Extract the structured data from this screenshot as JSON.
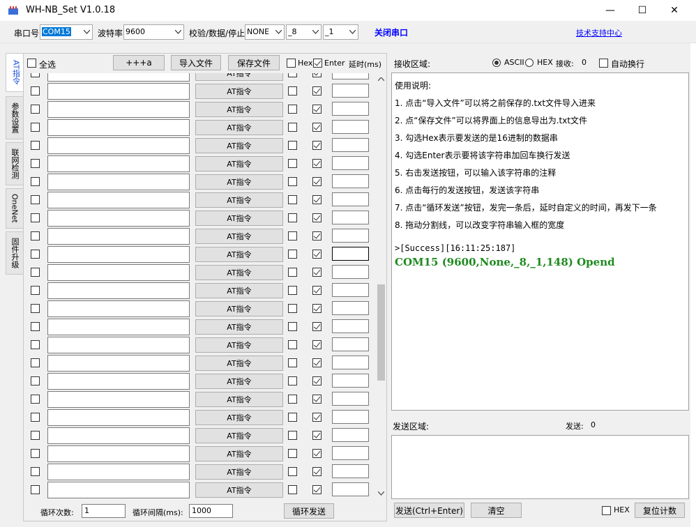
{
  "window": {
    "title": "WH-NB_Set V1.0.18",
    "minimize": "—",
    "maximize": "☐",
    "close": "✕"
  },
  "toolbar": {
    "port_label": "串口号",
    "port_value": "COM15",
    "baud_label": "波特率",
    "baud_value": "9600",
    "parity_label": "校验/数据/停止",
    "parity_value": "NONE",
    "data_bits_value": "_8",
    "stop_bits_value": "_1",
    "close_port_label": "关闭串口",
    "support_link": "技术支持中心"
  },
  "tabs": [
    {
      "label": "AT指令",
      "active": true
    },
    {
      "label": "参数设置",
      "active": false
    },
    {
      "label": "联网检测",
      "active": false
    },
    {
      "label": "OneNet",
      "active": false
    },
    {
      "label": "固件升级",
      "active": false
    }
  ],
  "left_panel": {
    "select_all_label": "全选",
    "plus_button": "+++a",
    "import_button": "导入文件",
    "save_button": "保存文件",
    "hex_label": "Hex",
    "enter_label": "Enter",
    "delay_label": "延时(ms)",
    "at_button_label": "AT指令",
    "row_count": 24,
    "loop_count_label": "循环次数:",
    "loop_count_value": "1",
    "loop_interval_label": "循环间隔(ms):",
    "loop_interval_value": "1000",
    "loop_send_button": "循环发送"
  },
  "receive": {
    "label": "接收区域:",
    "ascii_label": "ASCII",
    "hex_label": "HEX",
    "recv_count_label": "接收:",
    "recv_count_value": "0",
    "auto_wrap_label": "自动换行",
    "mode": "ASCII",
    "usage_lines": [
      "使用说明:",
      "1. 点击“导入文件”可以将之前保存的.txt文件导入进来",
      "2. 点“保存文件”可以将界面上的信息导出为.txt文件",
      "3. 勾选Hex表示要发送的是16进制的数据串",
      "4. 勾选Enter表示要将该字符串加回车换行发送",
      "5. 右击发送按钮，可以输入该字符串的注释",
      "6. 点击每行的发送按钮，发送该字符串",
      "7. 点击“循环发送”按钮，发完一条后，延时自定义的时间，再发下一条",
      "8. 拖动分割线，可以改变字符串输入框的宽度"
    ],
    "success_line": ">[Success][16:11:25:187]",
    "opend_line": "COM15 (9600,None,_8,_1,148) Opend"
  },
  "send": {
    "label": "发送区域:",
    "send_count_label": "发送:",
    "send_count_value": "0",
    "send_button": "发送(Ctrl+Enter)",
    "clear_button": "清空",
    "hex_label": "HEX",
    "reset_count_button": "复位计数"
  },
  "colors": {
    "accent_blue": "#0000ff",
    "success_green": "#1f8a1f",
    "selection": "#0078d7"
  }
}
